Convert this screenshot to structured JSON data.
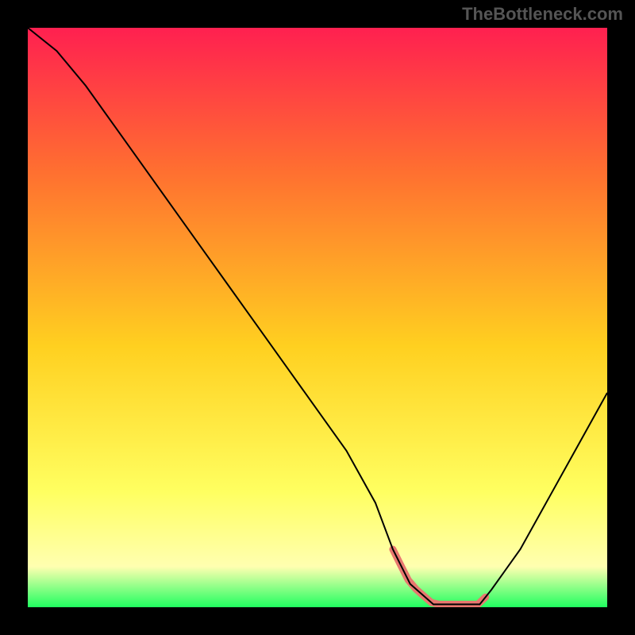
{
  "watermark": "TheBottleneck.com",
  "chart_data": {
    "type": "line",
    "title": "",
    "xlabel": "",
    "ylabel": "",
    "xlim": [
      0,
      100
    ],
    "ylim": [
      0,
      100
    ],
    "x": [
      0,
      5,
      10,
      15,
      20,
      25,
      30,
      35,
      40,
      45,
      50,
      55,
      60,
      63,
      66,
      70,
      74,
      78,
      80,
      85,
      90,
      95,
      100
    ],
    "values": [
      100,
      96,
      90,
      83,
      76,
      69,
      62,
      55,
      48,
      41,
      34,
      27,
      18,
      10,
      4,
      0.5,
      0.5,
      0.5,
      3,
      10,
      19,
      28,
      37
    ],
    "highlight_range_x": [
      63,
      79
    ],
    "background_gradient": {
      "top": "#ff2050",
      "upper_mid": "#ff7030",
      "mid": "#ffd020",
      "lower_mid": "#ffff60",
      "near_bottom": "#ffffb0",
      "bottom": "#20ff60"
    }
  }
}
